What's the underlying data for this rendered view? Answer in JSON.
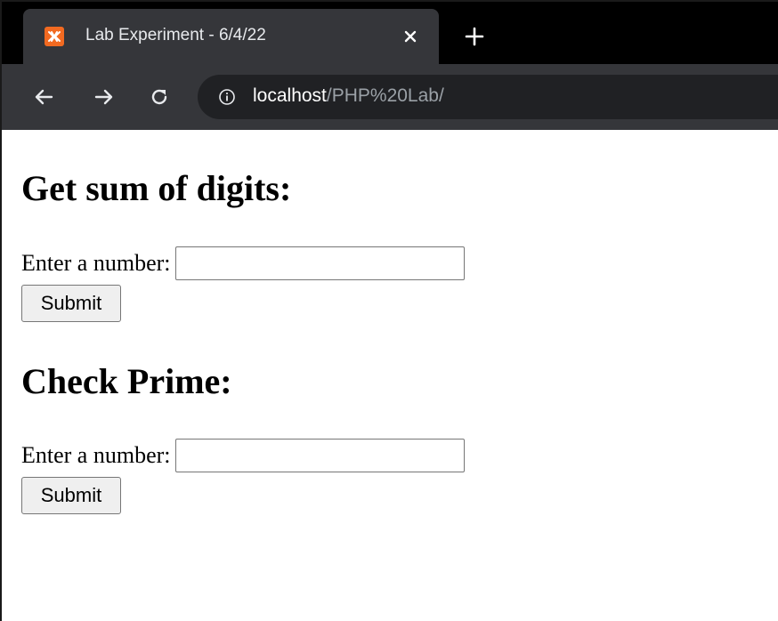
{
  "browser": {
    "tab": {
      "title": "Lab Experiment - 6/4/22",
      "favicon": "xampp-icon",
      "close_icon": "close-icon"
    },
    "new_tab_icon": "plus-icon",
    "nav": {
      "back_icon": "arrow-left-icon",
      "forward_icon": "arrow-right-icon",
      "reload_icon": "reload-icon"
    },
    "address": {
      "info_icon": "info-icon",
      "host": "localhost",
      "path": "/PHP%20Lab/"
    },
    "colors": {
      "tabstrip": "#000000",
      "toolbar": "#35363a",
      "omnibox": "#202124",
      "favicon": "#f26a21"
    }
  },
  "page": {
    "sections": [
      {
        "heading": "Get sum of digits:",
        "label": "Enter a number:",
        "value": "",
        "button": "Submit"
      },
      {
        "heading": "Check Prime:",
        "label": "Enter a number:",
        "value": "",
        "button": "Submit"
      }
    ]
  }
}
